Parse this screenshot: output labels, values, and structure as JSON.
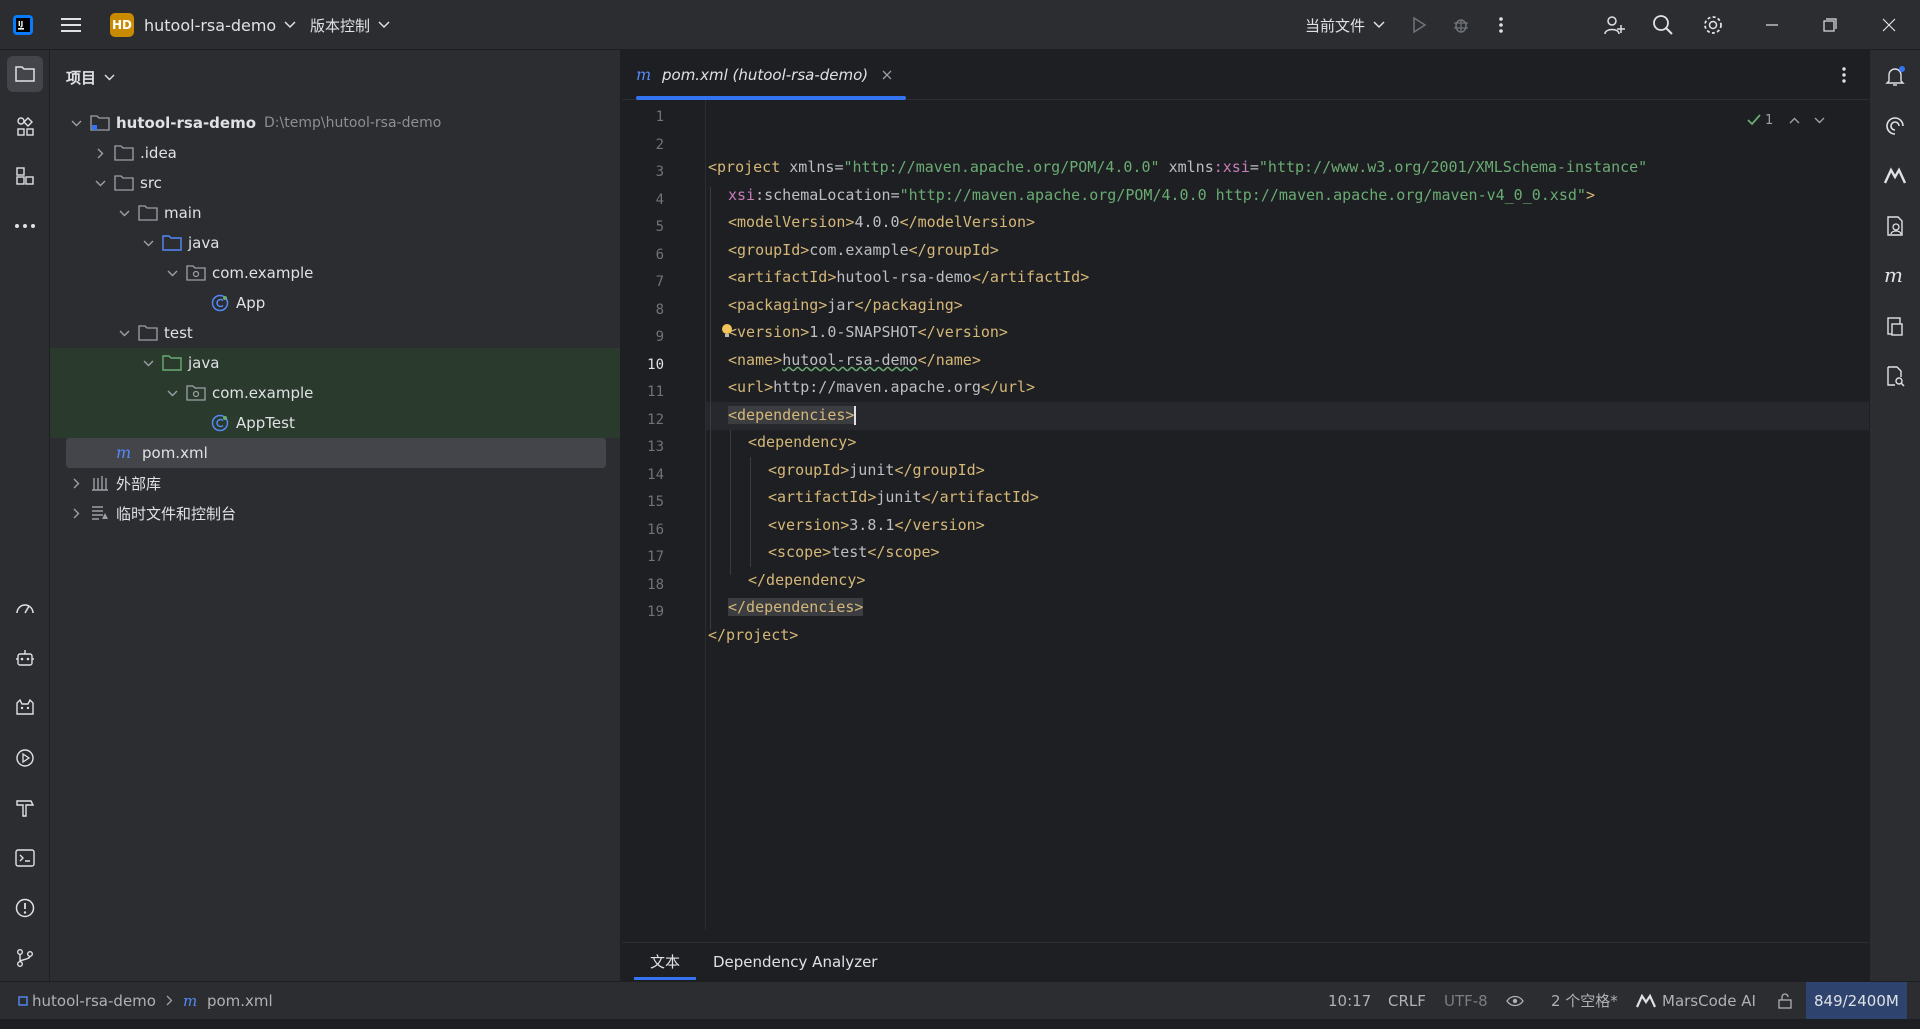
{
  "titlebar": {
    "project_badge": "HD",
    "project_name": "hutool-rsa-demo",
    "vcs_label": "版本控制",
    "run_config": "当前文件"
  },
  "project_panel": {
    "title": "项目",
    "tree": [
      {
        "label": "hutool-rsa-demo",
        "path": "D:\\temp\\hutool-rsa-demo"
      },
      {
        "label": ".idea"
      },
      {
        "label": "src"
      },
      {
        "label": "main"
      },
      {
        "label": "java"
      },
      {
        "label": "com.example"
      },
      {
        "label": "App"
      },
      {
        "label": "test"
      },
      {
        "label": "java"
      },
      {
        "label": "com.example"
      },
      {
        "label": "AppTest"
      },
      {
        "label": "pom.xml"
      },
      {
        "label": "外部库"
      },
      {
        "label": "临时文件和控制台"
      }
    ]
  },
  "editor": {
    "tab_label": "pom.xml (hutool-rsa-demo)",
    "inspection_count": "1",
    "line_numbers": [
      "1",
      "2",
      "3",
      "4",
      "5",
      "6",
      "7",
      "8",
      "9",
      "10",
      "11",
      "12",
      "13",
      "14",
      "15",
      "16",
      "17",
      "18",
      "19"
    ],
    "lines": {
      "l1": {
        "t1": "<project ",
        "a1": "xmlns",
        "eq1": "=",
        "s1": "\"http://maven.apache.org/POM/4.0.0\"",
        "a2": " xmlns",
        "ns": ":xsi",
        "eq2": "=",
        "s2": "\"http://www.w3.org/2001/XMLSchema-instance\""
      },
      "l2": {
        "ns": "xsi",
        "a": ":schemaLocation",
        "eq": "=",
        "s": "\"http://maven.apache.org/POM/4.0.0 http://maven.apache.org/maven-v4_0_0.xsd\"",
        "close": ">"
      },
      "l3": {
        "open": "<modelVersion>",
        "val": "4.0.0",
        "close": "</modelVersion>"
      },
      "l4": {
        "open": "<groupId>",
        "val": "com.example",
        "close": "</groupId>"
      },
      "l5": {
        "open": "<artifactId>",
        "val": "hutool-rsa-demo",
        "close": "</artifactId>"
      },
      "l6": {
        "open": "<packaging>",
        "val": "jar",
        "close": "</packaging>"
      },
      "l7": {
        "open": "<version>",
        "val": "1.0-SNAPSHOT",
        "close": "</version>"
      },
      "l8": {
        "open": "<name>",
        "val": "hutool-rsa-demo",
        "close": "</name>"
      },
      "l9": {
        "open": "<url>",
        "val": "http://maven.apache.org",
        "close": "</url>"
      },
      "l10": {
        "open": "<dependencies>"
      },
      "l11": {
        "open": "<dependency>"
      },
      "l12": {
        "open": "<groupId>",
        "val": "junit",
        "close": "</groupId>"
      },
      "l13": {
        "open": "<artifactId>",
        "val": "junit",
        "close": "</artifactId>"
      },
      "l14": {
        "open": "<version>",
        "val": "3.8.1",
        "close": "</version>"
      },
      "l15": {
        "open": "<scope>",
        "val": "test",
        "close": "</scope>"
      },
      "l16": {
        "close": "</dependency>"
      },
      "l17": {
        "close": "</dependencies>"
      },
      "l18": {
        "close": "</project>"
      }
    },
    "bottom_tabs": [
      "文本",
      "Dependency Analyzer"
    ]
  },
  "statusbar": {
    "breadcrumb_project": "hutool-rsa-demo",
    "breadcrumb_file": "pom.xml",
    "caret": "10:17",
    "line_sep": "CRLF",
    "encoding": "UTF-8",
    "indent": "2 个空格*",
    "ai": "MarsCode AI",
    "memory": "849/2400M"
  },
  "colors": {
    "accent": "#3574f0",
    "tag": "#d5b778",
    "string": "#6aab73",
    "namespace": "#c77dbb",
    "badge": "#c88a00"
  }
}
